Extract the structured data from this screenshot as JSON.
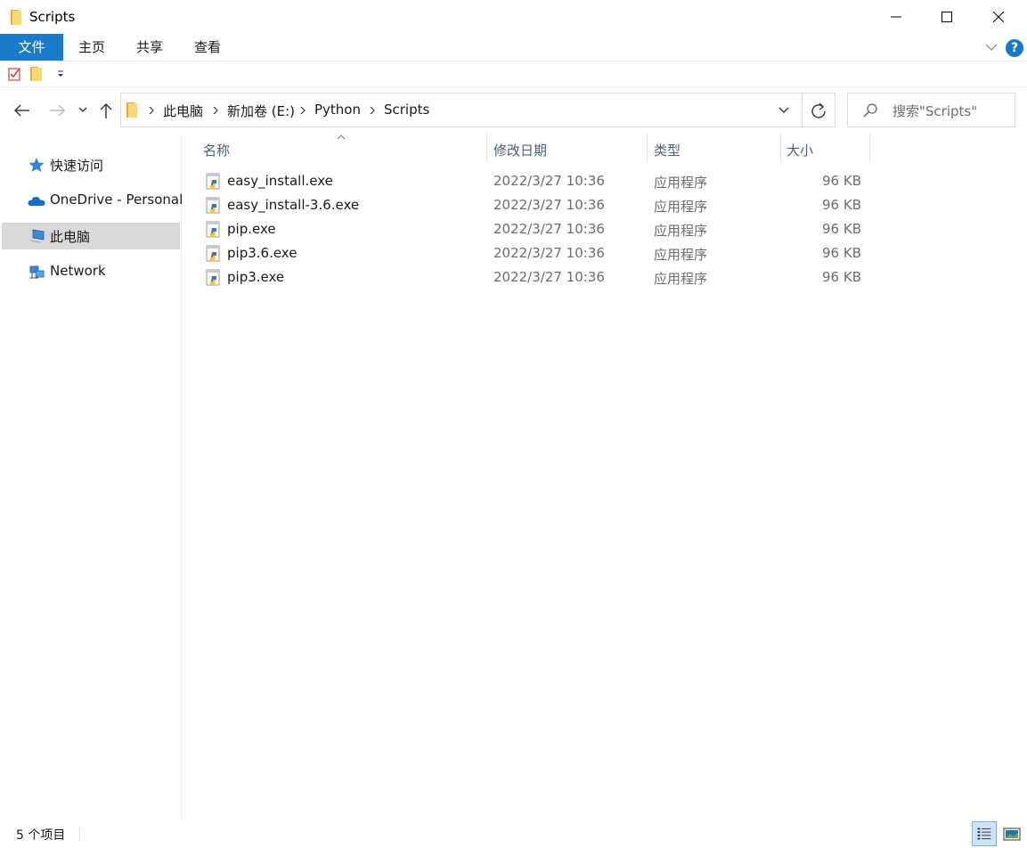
{
  "window": {
    "title": "Scripts"
  },
  "ribbon": {
    "tabs": [
      "文件",
      "主页",
      "共享",
      "查看"
    ]
  },
  "address": {
    "crumbs": [
      "此电脑",
      "新加卷 (E:)",
      "Python",
      "Scripts"
    ]
  },
  "search": {
    "placeholder": "搜索\"Scripts\""
  },
  "navpane": {
    "items": [
      {
        "label": "快速访问",
        "icon": "star-icon"
      },
      {
        "label": "OneDrive - Personal",
        "icon": "cloud-icon"
      },
      {
        "label": "此电脑",
        "icon": "computer-icon",
        "selected": true
      },
      {
        "label": "Network",
        "icon": "network-icon"
      }
    ]
  },
  "columns": {
    "name": "名称",
    "date": "修改日期",
    "type": "类型",
    "size": "大小"
  },
  "files": [
    {
      "name": "easy_install.exe",
      "date": "2022/3/27 10:36",
      "type": "应用程序",
      "size": "96 KB"
    },
    {
      "name": "easy_install-3.6.exe",
      "date": "2022/3/27 10:36",
      "type": "应用程序",
      "size": "96 KB"
    },
    {
      "name": "pip.exe",
      "date": "2022/3/27 10:36",
      "type": "应用程序",
      "size": "96 KB"
    },
    {
      "name": "pip3.6.exe",
      "date": "2022/3/27 10:36",
      "type": "应用程序",
      "size": "96 KB"
    },
    {
      "name": "pip3.exe",
      "date": "2022/3/27 10:36",
      "type": "应用程序",
      "size": "96 KB"
    }
  ],
  "status": {
    "count": "5 个项目"
  },
  "colors": {
    "accent": "#1979ca",
    "selection": "#d9d9d9"
  }
}
